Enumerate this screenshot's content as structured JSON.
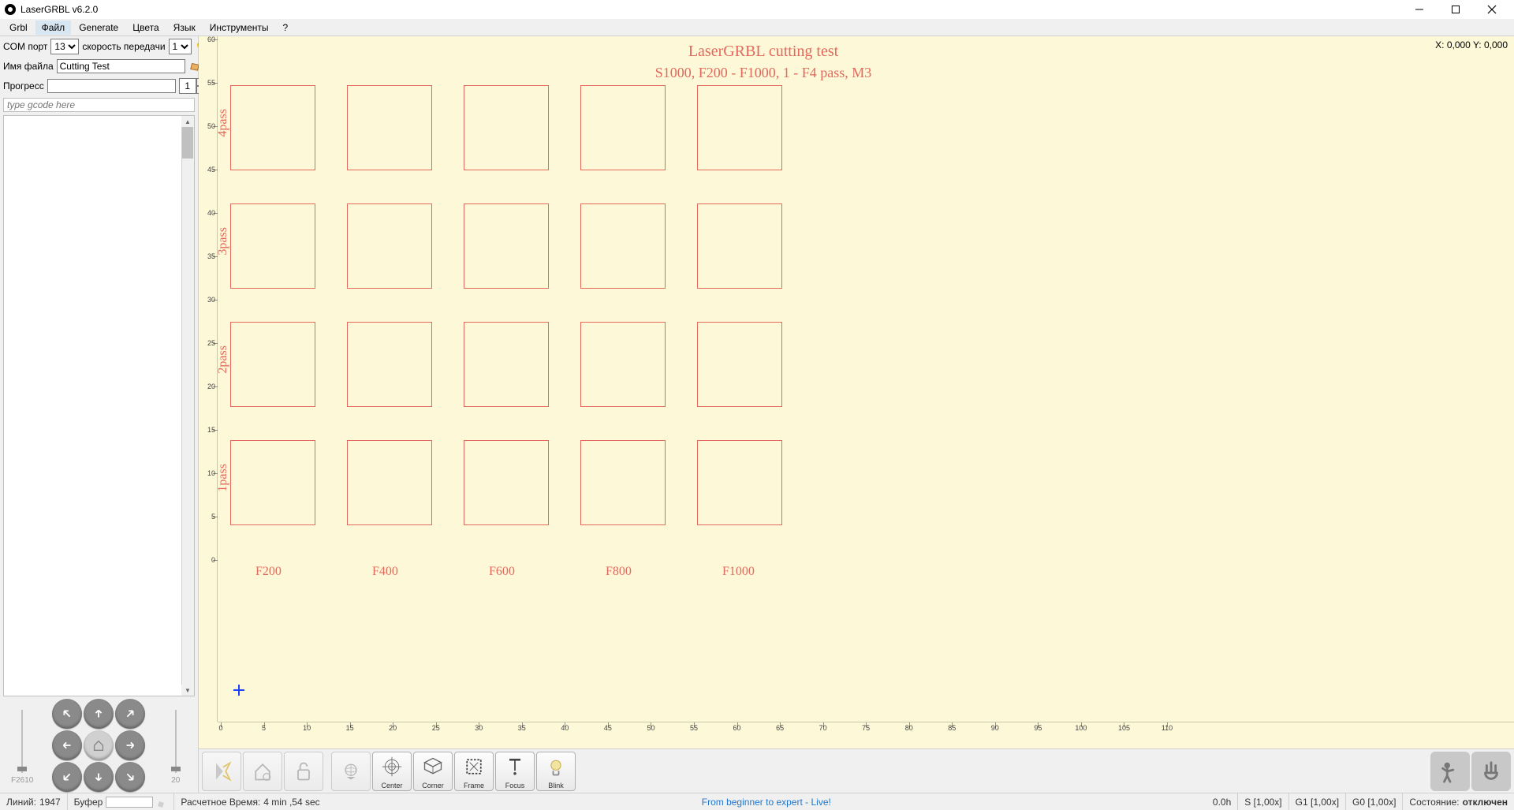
{
  "title": "LaserGRBL v6.2.0",
  "menus": [
    "Grbl",
    "Файл",
    "Generate",
    "Цвета",
    "Язык",
    "Инструменты",
    "?"
  ],
  "menu_highlight_index": 1,
  "conn": {
    "com_label": "COM порт",
    "com_value": "13",
    "baud_label": "скорость передачи",
    "baud_value": "1"
  },
  "file": {
    "label": "Имя файла",
    "value": "Cutting Test"
  },
  "progress": {
    "label": "Прогресс",
    "value": "",
    "passes": "1"
  },
  "gcode_placeholder": "type gcode here",
  "jog": {
    "left_label": "F2610",
    "right_label": "20"
  },
  "coord": "X: 0,000 Y: 0,000",
  "preview": {
    "title": "LaserGRBL cutting test",
    "subtitle": "S1000, F200 - F1000, 1 - F4 pass, M3",
    "passes": [
      "4pass",
      "3pass",
      "2pass",
      "1pass"
    ],
    "speeds": [
      "F200",
      "F400",
      "F600",
      "F800",
      "F1000"
    ]
  },
  "ruler_v": [
    "60",
    "55",
    "50",
    "45",
    "40",
    "35",
    "30",
    "25",
    "20",
    "15",
    "10",
    "5",
    "0"
  ],
  "ruler_h": [
    "0",
    "5",
    "10",
    "15",
    "20",
    "25",
    "30",
    "35",
    "40",
    "45",
    "50",
    "55",
    "60",
    "65",
    "70",
    "75",
    "80",
    "85",
    "90",
    "95",
    "100",
    "105",
    "110"
  ],
  "toolbar": {
    "center": "Center",
    "corner": "Corner",
    "frame": "Frame",
    "focus": "Focus",
    "blink": "Blink"
  },
  "status": {
    "lines_label": "Линий:",
    "lines_value": "1947",
    "buffer_label": "Буфер",
    "time_label": "Расчетное Время:",
    "time_value": "4 min ,54 sec",
    "link": "From beginner to expert - Live!",
    "hours": "0.0h",
    "s": "S [1,00x]",
    "g1": "G1 [1,00x]",
    "g0": "G0 [1,00x]",
    "state_label": "Состояние:",
    "state_value": "отключен"
  }
}
